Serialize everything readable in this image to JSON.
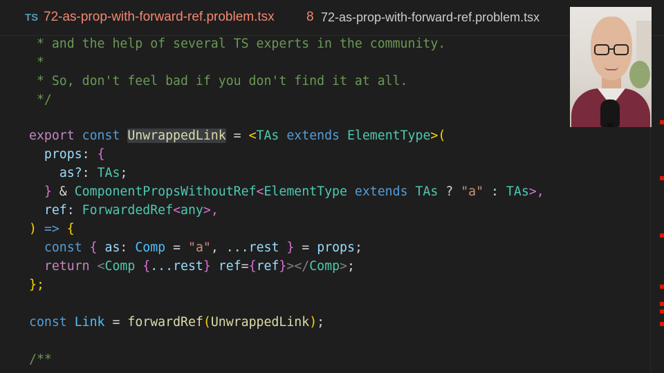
{
  "tab": {
    "icon_label": "TS",
    "title": "72-as-prop-with-forward-ref.problem.tsx",
    "error_count": "8",
    "description": "72-as-prop-with-forward-ref.problem.tsx"
  },
  "code": {
    "l1_comment": " * and the help of several TS experts in the community.",
    "l2_comment": " *",
    "l3_comment": " * So, don't feel bad if you don't find it at all.",
    "l4_comment": " */",
    "export": "export",
    "const": "const",
    "unwrapped_link": "UnwrappedLink",
    "eq": " = ",
    "lt": "<",
    "tas": "TAs",
    "extends": "extends",
    "element_type": "ElementType",
    "gt_paren": ">(",
    "props": "props",
    "colon": ": ",
    "open_brace": "{",
    "as_opt": "as?",
    "semicolon": ";",
    "close_brace": "}",
    "amp": " & ",
    "component_props": "ComponentPropsWithoutRef",
    "question": " ? ",
    "a_str": "\"a\"",
    "ternary_colon": " : ",
    "gt_comma": ">,",
    "ref": "ref",
    "forwarded_ref": "ForwardedRef",
    "any": "any",
    "arrow_line_paren": ")",
    "arrow": " => ",
    "as": "as",
    "comp": "Comp",
    "spread_rest": "...rest",
    "return": "return",
    "close_tag_gt": "></",
    "end_semi": "};",
    "link": "Link",
    "forward_ref": "forwardRef",
    "doc_open": "/**"
  },
  "colors": {
    "background": "#1e1e1e",
    "comment": "#6a9955",
    "keyword_purple": "#c586c0",
    "keyword_blue": "#569cd6",
    "type": "#4ec9b0",
    "function": "#dcdcaa",
    "string": "#ce9178",
    "error_mark": "#e51400"
  }
}
